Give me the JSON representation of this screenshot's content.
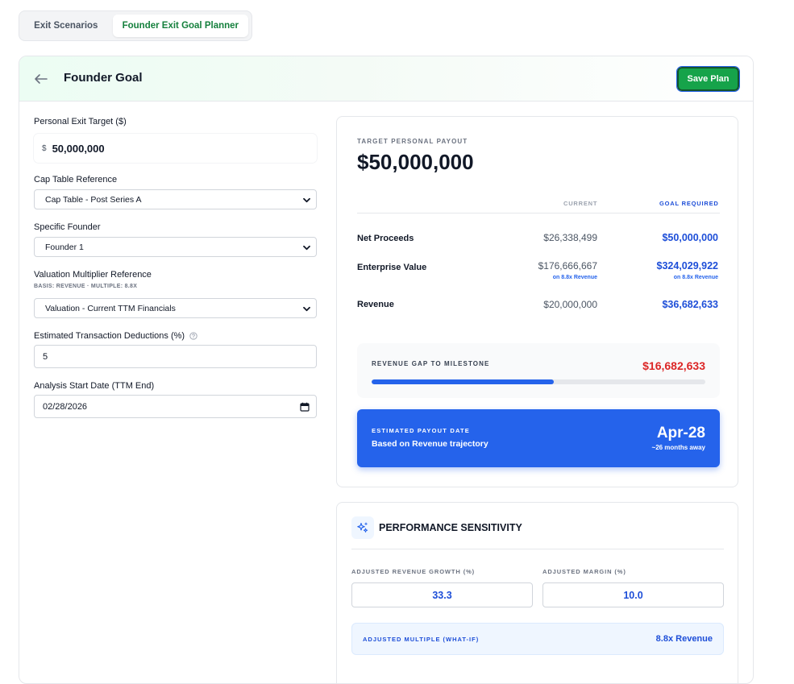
{
  "tabs": [
    {
      "label": "Exit Scenarios",
      "active": false
    },
    {
      "label": "Founder Exit Goal Planner",
      "active": true
    }
  ],
  "header": {
    "title": "Founder Goal",
    "save_label": "Save Plan"
  },
  "form": {
    "exit_target_label": "Personal Exit Target ($)",
    "exit_target_currency": "$",
    "exit_target_value": "50,000,000",
    "cap_table_label": "Cap Table Reference",
    "cap_table_value": "Cap Table - Post Series A",
    "founder_label": "Specific Founder",
    "founder_value": "Founder 1",
    "valuation_label": "Valuation Multiplier Reference",
    "valuation_basis": "BASIS: REVENUE · MULTIPLE: 8.8X",
    "valuation_value": "Valuation - Current TTM Financials",
    "deductions_label": "Estimated Transaction Deductions (%)",
    "deductions_value": "5",
    "start_date_label": "Analysis Start Date (TTM End)",
    "start_date_value": "02/28/2026"
  },
  "summary": {
    "target_label": "TARGET PERSONAL PAYOUT",
    "target_value": "$50,000,000",
    "col_current": "CURRENT",
    "col_goal": "GOAL REQUIRED",
    "rows": [
      {
        "label": "Net Proceeds",
        "current": "$26,338,499",
        "goal": "$50,000,000"
      },
      {
        "label": "Enterprise Value",
        "current": "$176,666,667",
        "current_note": "on 8.8x Revenue",
        "goal": "$324,029,922",
        "goal_note": "on 8.8x Revenue"
      },
      {
        "label": "Revenue",
        "current": "$20,000,000",
        "goal": "$36,682,633"
      }
    ],
    "gap_label": "REVENUE GAP TO MILESTONE",
    "gap_value": "$16,682,633",
    "gap_progress": 0.545,
    "payout_label": "ESTIMATED PAYOUT DATE",
    "payout_sub": "Based on Revenue trajectory",
    "payout_date": "Apr-28",
    "payout_away": "~26 months away"
  },
  "sensitivity": {
    "title": "PERFORMANCE SENSITIVITY",
    "growth_label": "ADJUSTED REVENUE GROWTH (%)",
    "growth_value": "33.3",
    "margin_label": "ADJUSTED MARGIN (%)",
    "margin_value": "10.0",
    "multiple_label": "ADJUSTED MULTIPLE (WHAT-IF)",
    "multiple_value": "8.8x Revenue"
  },
  "colors": {
    "accent_green": "#16a34a",
    "accent_blue": "#2563eb",
    "gap_red": "#dc2626"
  },
  "icons": [
    "back-arrow-icon",
    "chevron-down-icon",
    "help-circle-icon",
    "calendar-icon",
    "sparkles-icon"
  ]
}
